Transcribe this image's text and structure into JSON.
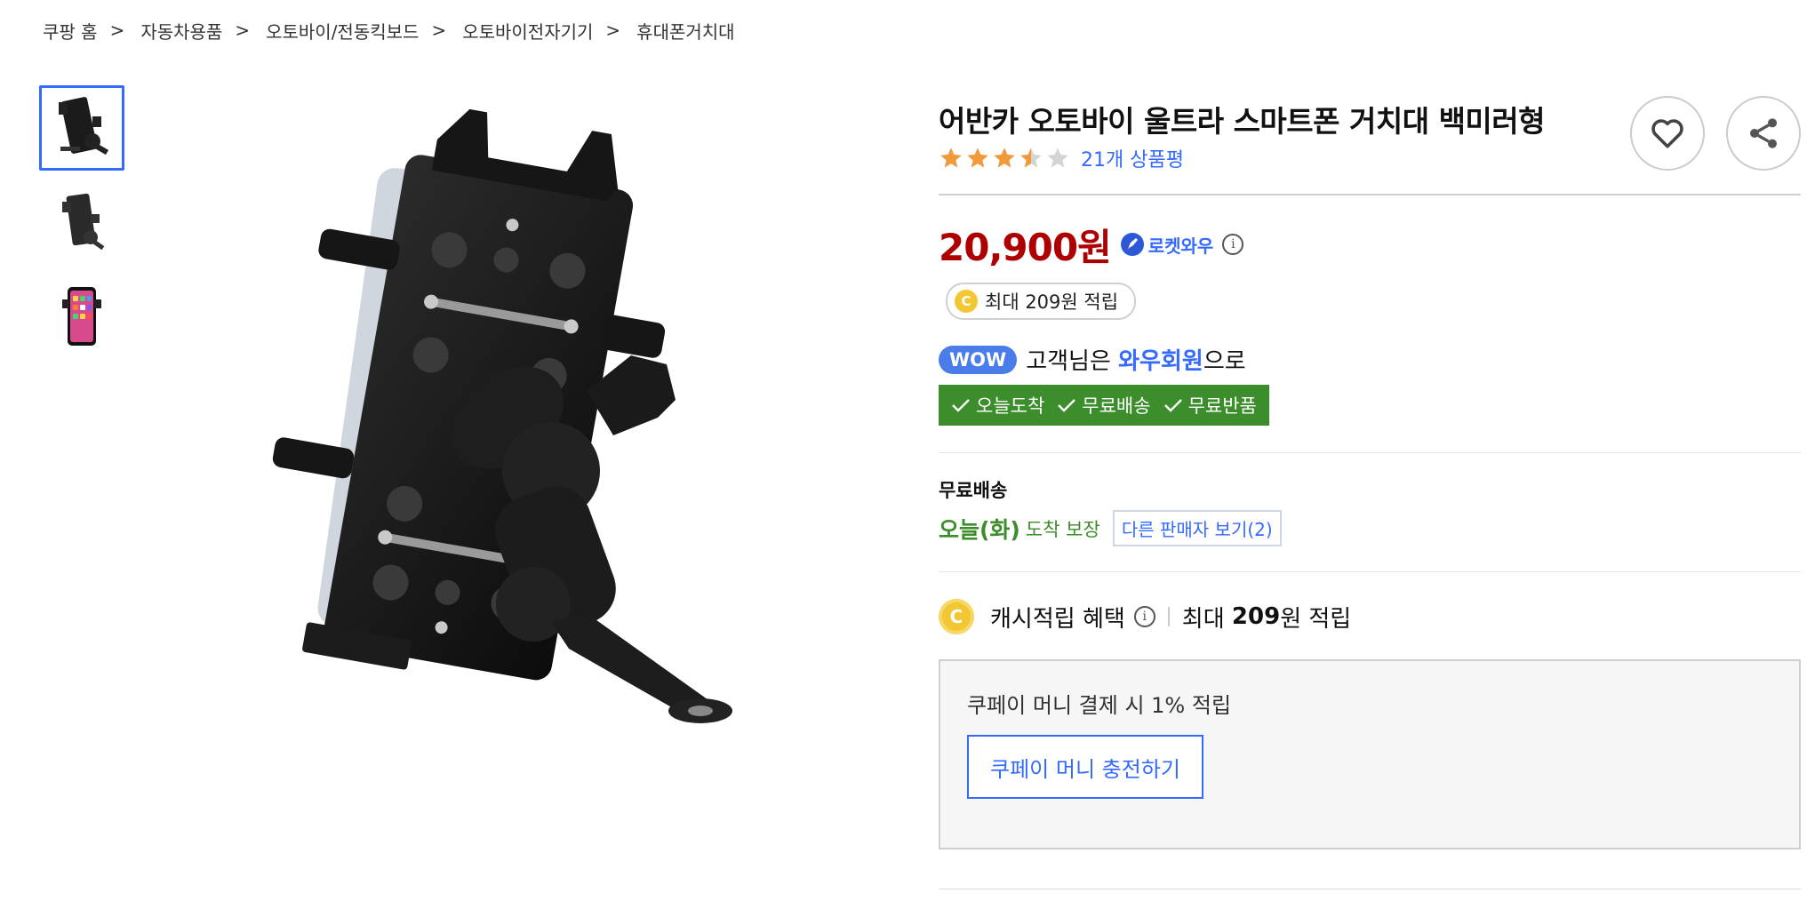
{
  "breadcrumb": [
    {
      "label": "쿠팡 홈"
    },
    {
      "label": "자동차용품"
    },
    {
      "label": "오토바이/전동킥보드"
    },
    {
      "label": "오토바이전자기기"
    },
    {
      "label": "휴대폰거치대"
    }
  ],
  "breadcrumb_separator": ">",
  "product": {
    "title": "어반카 오토바이 울트라 스마트폰 거치대 백미러형",
    "rating": 3.5,
    "rating_max": 5,
    "review_link": "21개 상품평",
    "price": "20,900원",
    "rocket_badge": "로켓와우",
    "cash_pill": "최대 209원 적립"
  },
  "wow": {
    "badge": "WOW",
    "text_before": "고객님은 ",
    "member": "와우회원",
    "text_after": "으로",
    "perks": [
      "오늘도착",
      "무료배송",
      "무료반품"
    ]
  },
  "shipping": {
    "label": "무료배송",
    "today": "오늘(화)",
    "arrive": "도착 보장",
    "other_sellers": "다른 판매자 보기(2)"
  },
  "benefit": {
    "coin": "C",
    "label": "캐시적립 혜택",
    "amount_prefix": "최대 ",
    "amount": "209",
    "amount_suffix": "원 적립"
  },
  "coupay": {
    "text": "쿠페이 머니 결제 시 1% 적립",
    "button": "쿠페이 머니 충전하기"
  },
  "colors": {
    "accent_blue": "#346aff",
    "price_red": "#ae0000",
    "wow_green": "#3c8d2b",
    "star": "#f29a3a"
  },
  "icons": {
    "like": "heart-icon",
    "share": "share-icon",
    "info": "info-icon",
    "rocket": "rocket-icon",
    "check": "check-icon"
  }
}
